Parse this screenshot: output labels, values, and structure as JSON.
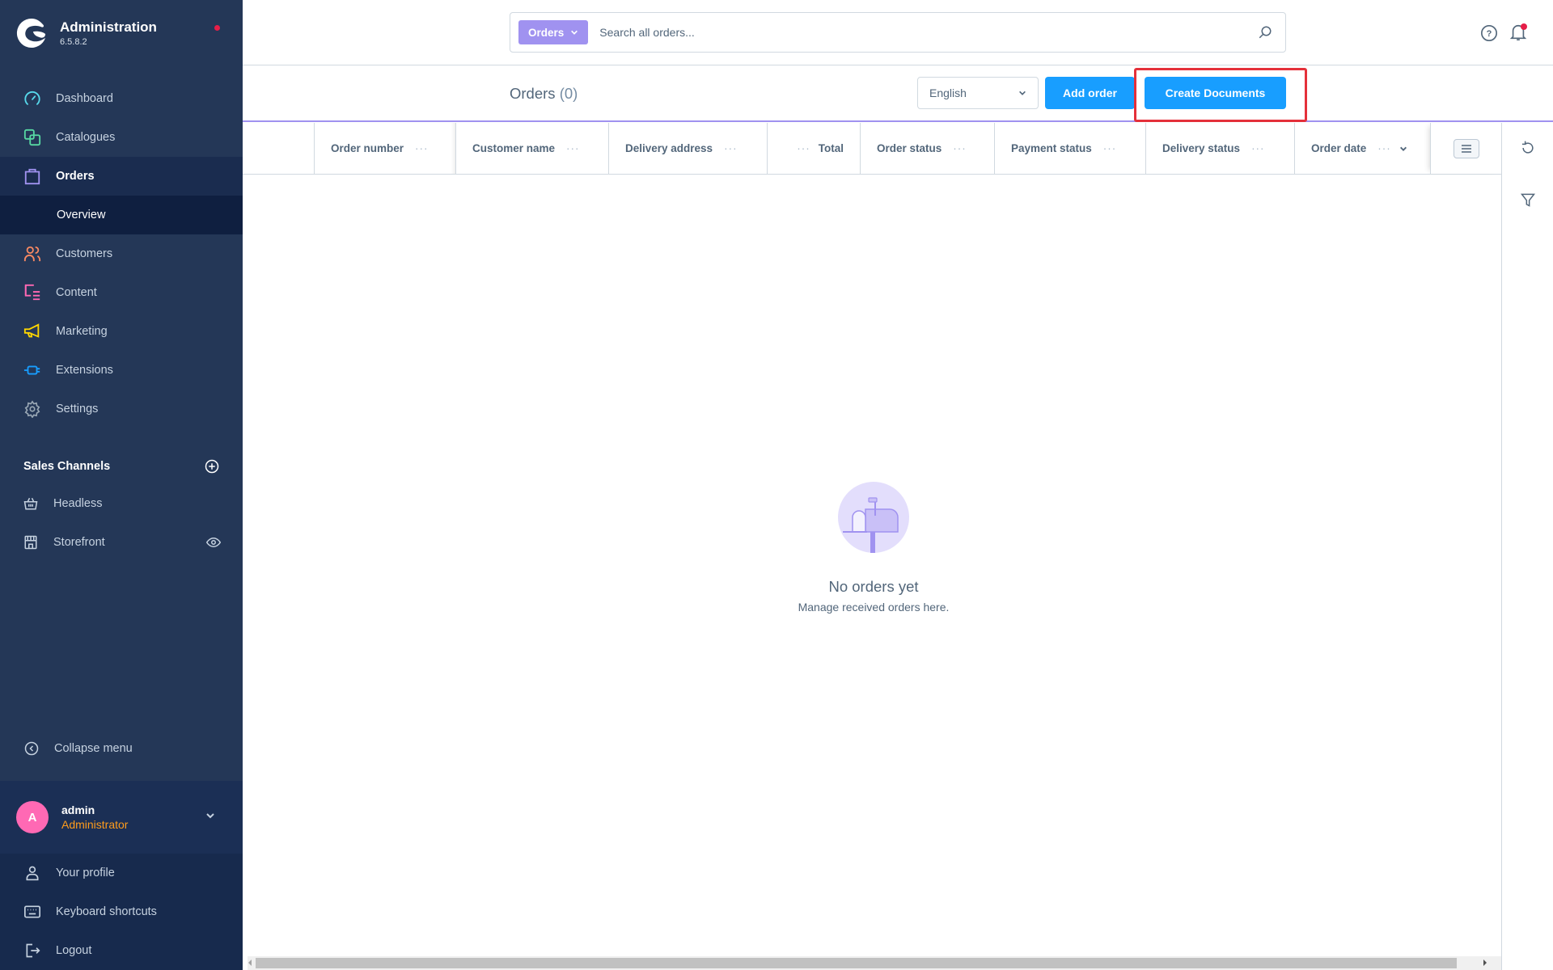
{
  "app": {
    "title": "Administration",
    "version": "6.5.8.2"
  },
  "nav": {
    "items": [
      {
        "label": "Dashboard",
        "icon": "dashboard-icon",
        "color": "#57d9eb"
      },
      {
        "label": "Catalogues",
        "icon": "catalogue-icon",
        "color": "#57d9a3"
      },
      {
        "label": "Orders",
        "icon": "orders-bag-icon",
        "color": "#a092f0",
        "active": true
      },
      {
        "label": "Customers",
        "icon": "customers-icon",
        "color": "#f88962"
      },
      {
        "label": "Content",
        "icon": "content-icon",
        "color": "#ff68b4"
      },
      {
        "label": "Marketing",
        "icon": "marketing-megaphone-icon",
        "color": "#ffd700"
      },
      {
        "label": "Extensions",
        "icon": "extensions-plug-icon",
        "color": "#189eff"
      },
      {
        "label": "Settings",
        "icon": "gear-icon",
        "color": "#9aa8b5"
      }
    ],
    "orders_sub": "Overview"
  },
  "sales_channels": {
    "heading": "Sales Channels",
    "items": [
      {
        "label": "Headless",
        "icon": "basket-icon"
      },
      {
        "label": "Storefront",
        "icon": "storefront-icon"
      }
    ]
  },
  "collapse_label": "Collapse menu",
  "user": {
    "initial": "A",
    "name": "admin",
    "role": "Administrator"
  },
  "user_menu": [
    "Your profile",
    "Keyboard shortcuts",
    "Logout"
  ],
  "search": {
    "type_label": "Orders",
    "placeholder": "Search all orders..."
  },
  "page": {
    "title": "Orders",
    "count": "(0)"
  },
  "language_select": {
    "value": "English"
  },
  "buttons": {
    "add_order": "Add order",
    "create_documents": "Create Documents"
  },
  "table": {
    "columns": [
      "Order number",
      "Customer name",
      "Delivery address",
      "Total",
      "Order status",
      "Payment status",
      "Delivery status",
      "Order date"
    ],
    "rows": []
  },
  "empty_state": {
    "title": "No orders yet",
    "subtitle": "Manage received orders here."
  },
  "colors": {
    "accent": "#189eff",
    "module": "#a092f0",
    "highlight": "#e4303a",
    "sidebar": "#243757"
  }
}
